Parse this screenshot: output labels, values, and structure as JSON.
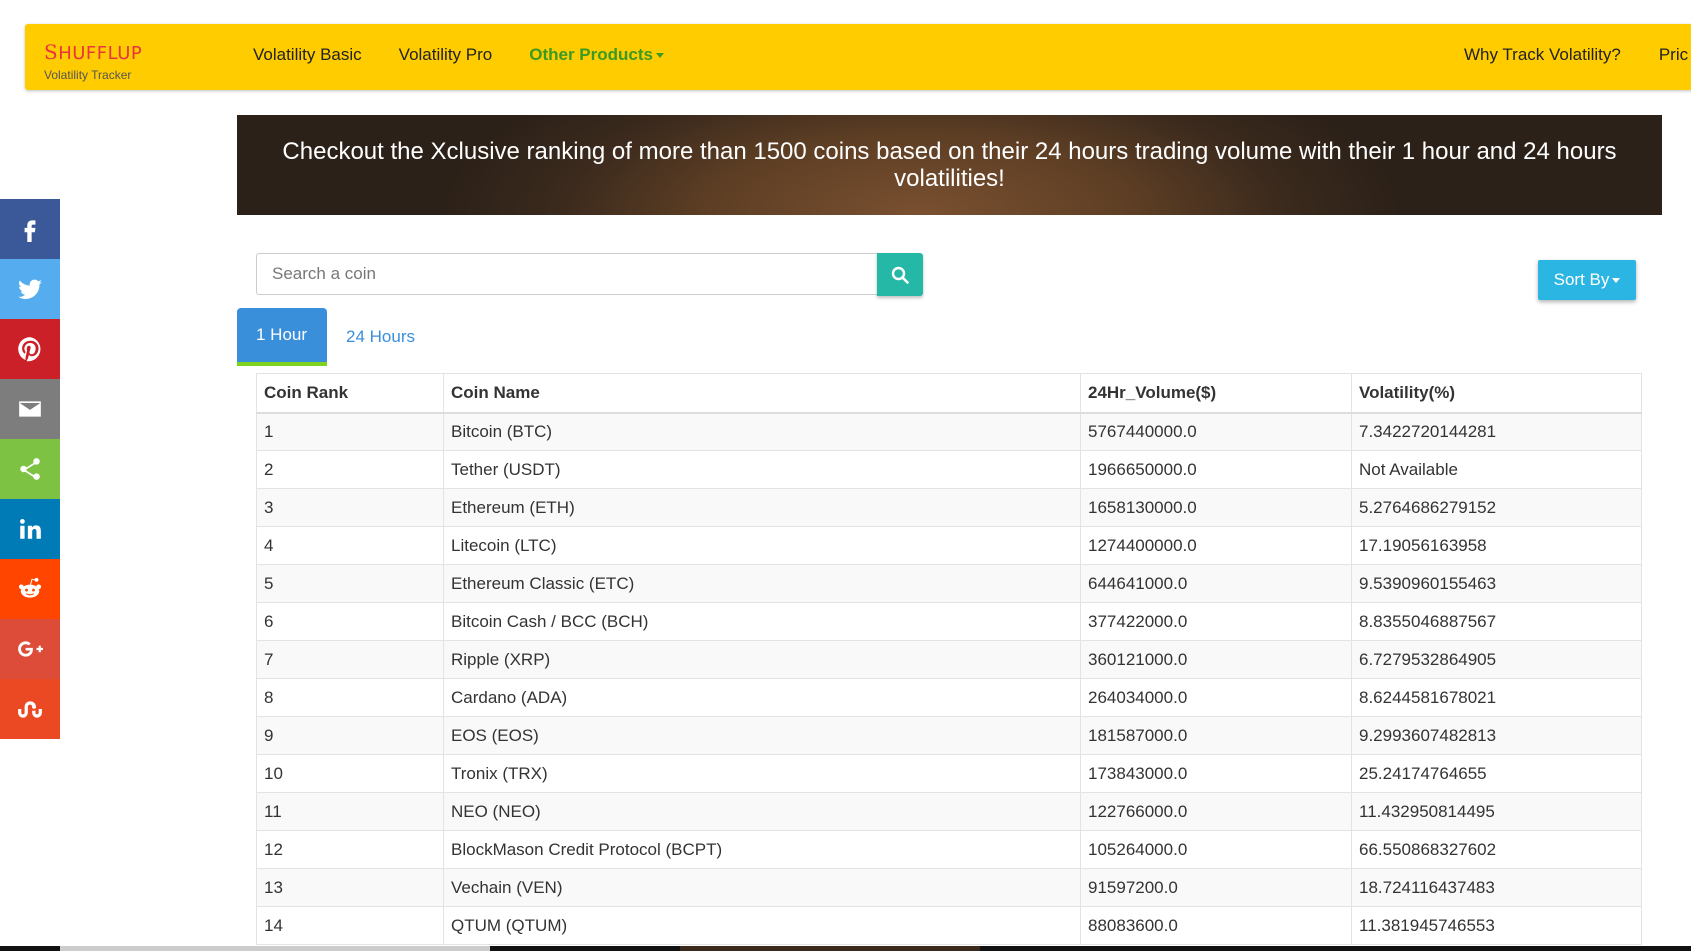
{
  "brand": {
    "name": "HUFFLUP",
    "initial": "S",
    "tagline": "Volatility Tracker"
  },
  "nav": {
    "links": [
      "Volatility Basic",
      "Volatility Pro",
      "Other Products"
    ],
    "right_links": [
      "Why Track Volatility?",
      "Pric"
    ]
  },
  "banner": {
    "text": "Checkout the Xclusive ranking of more than 1500 coins based on their 24 hours trading volume with their 1 hour and 24 hours volatilities!"
  },
  "search": {
    "placeholder": "Search a coin",
    "icon": "search-icon"
  },
  "sort": {
    "label": "Sort By"
  },
  "tabs": [
    {
      "label": "1 Hour",
      "active": true
    },
    {
      "label": "24 Hours",
      "active": false
    }
  ],
  "table": {
    "headers": [
      "Coin Rank",
      "Coin Name",
      "24Hr_Volume($)",
      "Volatility(%)"
    ],
    "rows": [
      [
        "1",
        "Bitcoin (BTC)",
        "5767440000.0",
        "7.3422720144281"
      ],
      [
        "2",
        "Tether (USDT)",
        "1966650000.0",
        "Not Available"
      ],
      [
        "3",
        "Ethereum (ETH)",
        "1658130000.0",
        "5.2764686279152"
      ],
      [
        "4",
        "Litecoin (LTC)",
        "1274400000.0",
        "17.19056163958"
      ],
      [
        "5",
        "Ethereum Classic (ETC)",
        "644641000.0",
        "9.5390960155463"
      ],
      [
        "6",
        "Bitcoin Cash / BCC (BCH)",
        "377422000.0",
        "8.8355046887567"
      ],
      [
        "7",
        "Ripple (XRP)",
        "360121000.0",
        "6.7279532864905"
      ],
      [
        "8",
        "Cardano (ADA)",
        "264034000.0",
        "8.6244581678021"
      ],
      [
        "9",
        "EOS (EOS)",
        "181587000.0",
        "9.2993607482813"
      ],
      [
        "10",
        "Tronix (TRX)",
        "173843000.0",
        "25.24174764655"
      ],
      [
        "11",
        "NEO (NEO)",
        "122766000.0",
        "11.432950814495"
      ],
      [
        "12",
        "BlockMason Credit Protocol (BCPT)",
        "105264000.0",
        "66.550868327602"
      ],
      [
        "13",
        "Vechain (VEN)",
        "91597200.0",
        "18.724116437483"
      ],
      [
        "14",
        "QTUM (QTUM)",
        "88083600.0",
        "11.381945746553"
      ]
    ]
  },
  "share": [
    {
      "name": "facebook",
      "color": "#3b5998",
      "icon": "facebook-icon"
    },
    {
      "name": "twitter",
      "color": "#55acee",
      "icon": "twitter-icon"
    },
    {
      "name": "pinterest",
      "color": "#cb2027",
      "icon": "pinterest-icon"
    },
    {
      "name": "email",
      "color": "#7d7d7d",
      "icon": "email-icon"
    },
    {
      "name": "share",
      "color": "#7dc242",
      "icon": "share-icon"
    },
    {
      "name": "linkedin",
      "color": "#007bb6",
      "icon": "linkedin-icon"
    },
    {
      "name": "reddit",
      "color": "#ff4500",
      "icon": "reddit-icon"
    },
    {
      "name": "googleplus",
      "color": "#dd4b39",
      "icon": "google-plus-icon"
    },
    {
      "name": "stumbleupon",
      "color": "#eb4924",
      "icon": "stumbleupon-icon"
    }
  ],
  "colors": {
    "navbar": "#ffcc00",
    "brand": "#e8353f",
    "products_link": "#3b9a24",
    "search_button": "#26b8a6",
    "sort_button": "#2bb5e3",
    "tab_active": "#3a8fdb",
    "tab_underline": "#7ed321"
  }
}
